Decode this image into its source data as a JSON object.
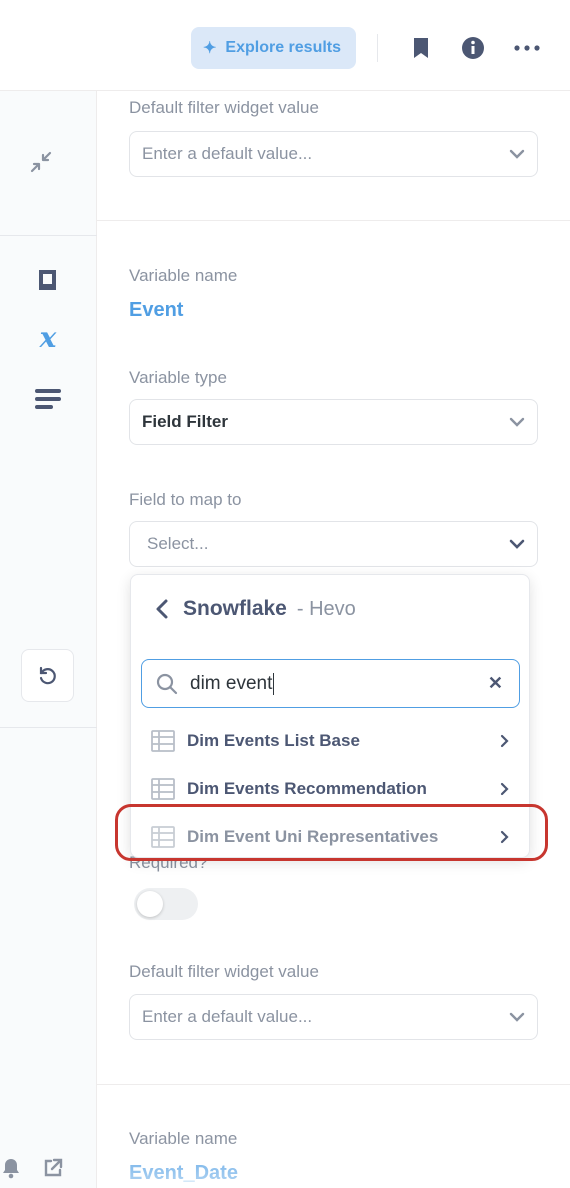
{
  "header": {
    "explore_label": "Explore results",
    "icons": [
      "sparkle-icon",
      "bookmark-icon",
      "info-icon",
      "more-icon"
    ]
  },
  "sidebar": {
    "icons": [
      "collapse-icon",
      "book-icon",
      "variable-icon",
      "snippets-icon",
      "refresh-icon",
      "bell-icon",
      "external-link-icon"
    ]
  },
  "panel": {
    "default_filter_label_top": "Default filter widget value",
    "default_placeholder_top": "Enter a default value...",
    "var1": {
      "name_label": "Variable name",
      "name": "Event",
      "type_label": "Variable type",
      "type_value": "Field Filter",
      "field_map_label": "Field to map to",
      "field_map_placeholder": "Select...",
      "required_label": "Required?",
      "default_label": "Default filter widget value",
      "default_placeholder": "Enter a default value..."
    },
    "var2": {
      "name_label": "Variable name",
      "name": "Event_Date"
    }
  },
  "dropdown": {
    "database": "Snowflake",
    "schema": "- Hevo",
    "search_value": "dim event",
    "items": [
      {
        "label": "Dim Events List Base"
      },
      {
        "label": "Dim Events Recommendation"
      },
      {
        "label": "Dim Event Uni Representatives"
      }
    ]
  },
  "colors": {
    "accent": "#509ee3",
    "highlight": "#c7362f",
    "text": "#4c5773",
    "muted": "#8b93a1"
  }
}
